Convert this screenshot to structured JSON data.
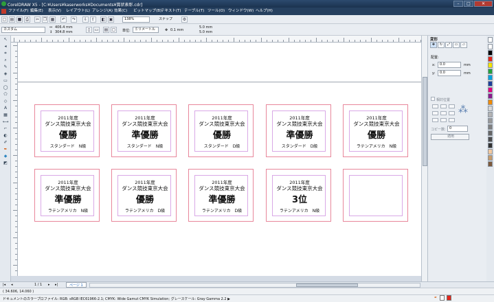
{
  "window": {
    "title": "CorelDRAW X5 - [C:¥Users¥kaserworks¥Documents¥賞状表彰.cdr]",
    "minimize": "–",
    "maximize": "□",
    "close": "✕"
  },
  "menu": [
    "ファイル(F)",
    "編集(E)",
    "表示(V)",
    "レイアウト(L)",
    "アレンジ(A)",
    "効果(C)",
    "ビットマップ(B)",
    "テキスト(T)",
    "テーブル(T)",
    "ツール(O)",
    "ウィンドウ(W)",
    "ヘルプ(H)"
  ],
  "toolbar": {
    "zoom": "138%",
    "snap": "スナップ"
  },
  "propbar": {
    "preset": "カスタム",
    "width": "406.4 mm",
    "height": "304.8 mm",
    "units_label": "単位:",
    "units": "ミリメートル",
    "nudge": "0.1 mm",
    "dup_x": "5.0 mm",
    "dup_y": "5.0 mm"
  },
  "cards": [
    {
      "year": "2011年度",
      "event": "ダンス競技東京大会",
      "award": "優勝",
      "category": "スタンダード　N級"
    },
    {
      "year": "2011年度",
      "event": "ダンス競技東京大会",
      "award": "準優勝",
      "category": "スタンダード　N級"
    },
    {
      "year": "2011年度",
      "event": "ダンス競技東京大会",
      "award": "優勝",
      "category": "スタンダード　D級"
    },
    {
      "year": "2011年度",
      "event": "ダンス競技東京大会",
      "award": "準優勝",
      "category": "スタンダード　D級"
    },
    {
      "year": "2011年度",
      "event": "ダンス競技東京大会",
      "award": "優勝",
      "category": "ラテンアメリカ　N級"
    },
    {
      "year": "2011年度",
      "event": "ダンス競技東京大会",
      "award": "準優勝",
      "category": "ラテンアメリカ　N級"
    },
    {
      "year": "2011年度",
      "event": "ダンス競技東京大会",
      "award": "優勝",
      "category": "ラテンアメリカ　D級"
    },
    {
      "year": "2011年度",
      "event": "ダンス競技東京大会",
      "award": "準優勝",
      "category": "ラテンアメリカ　D級"
    },
    {
      "year": "2011年度",
      "event": "ダンス競技東京大会",
      "award": "3位",
      "category": "ラテンアメリカ　N級"
    },
    {
      "year": "",
      "event": "",
      "award": "",
      "category": ""
    }
  ],
  "docker": {
    "title": "変形",
    "position_label": "配置:",
    "x_value": "0.0",
    "y_value": "0.0",
    "unit": "mm",
    "relative_label": "相対位置",
    "copies_label": "コピー数:",
    "copies_value": "0",
    "apply": "適用"
  },
  "pagebar": {
    "page_count": "1 / 1",
    "page_tab": "ページ 1"
  },
  "status": {
    "coords": "( 34.606, 14.060 )",
    "color_profile": "ドキュメントのカラープロファイル: RGB: sRGB IEC61966-2.1; CMYK: Wide Gamut CMYK Simulation; グレースケール: Gray Gamma 2.2 ▶"
  },
  "palette_colors": [
    "#ffffff",
    "#000000",
    "#e4261c",
    "#f5e400",
    "#24a13a",
    "#00a3e0",
    "#1d3f9a",
    "#e4007f",
    "#8b1d8c",
    "#f08a00",
    "#d8d8d8",
    "#b3b3b3",
    "#999999",
    "#808080",
    "#666666",
    "#4d4d4d",
    "#333333",
    "#f2c9a0",
    "#c69c6d",
    "#7e5a3c"
  ]
}
